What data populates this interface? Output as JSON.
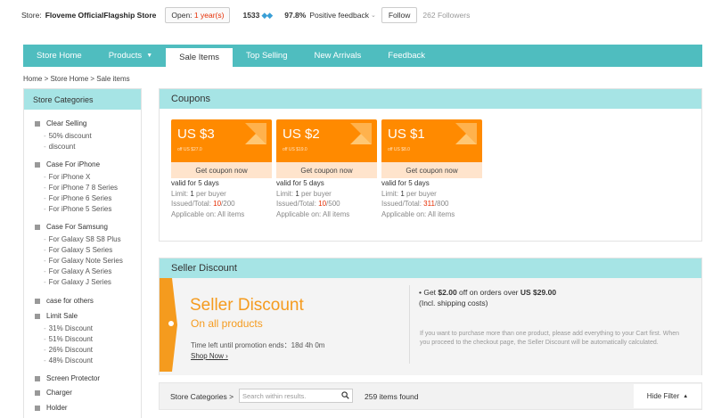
{
  "store": {
    "label": "Store:",
    "name": "Floveme OfficialFlagship Store",
    "open_prefix": "Open: ",
    "open_years": "1 year(s)",
    "score": "1533",
    "feedback_pct": "97.8%",
    "feedback_label": "Positive feedback",
    "follow_label": "Follow",
    "followers": "262 Followers"
  },
  "nav": {
    "items": [
      {
        "label": "Store Home"
      },
      {
        "label": "Products"
      },
      {
        "label": "Sale Items"
      },
      {
        "label": "Top Selling"
      },
      {
        "label": "New Arrivals"
      },
      {
        "label": "Feedback"
      }
    ],
    "active": "Sale Items"
  },
  "breadcrumb": "Home > Store Home > Sale items",
  "sidebar": {
    "title": "Store Categories",
    "categories": [
      {
        "label": "Clear Selling",
        "subs": [
          "50% discount",
          "discount"
        ]
      },
      {
        "label": "Case For iPhone",
        "subs": [
          "For iPhone X",
          "For iPhone 7 8 Series",
          "For iPhone 6 Series",
          "For iPhone 5 Series"
        ]
      },
      {
        "label": "Case For Samsung",
        "subs": [
          "For Galaxy S8 S8 Plus",
          "For Galaxy S Series",
          "For Galaxy Note Series",
          "For Galaxy A Series",
          "For Galaxy J Series"
        ]
      },
      {
        "label": "case for others",
        "subs": []
      },
      {
        "label": "Limit Sale",
        "subs": [
          "31% Discount",
          "51% Discount",
          "26% Discount",
          "48% Discount"
        ]
      },
      {
        "label": "Screen Protector",
        "subs": []
      },
      {
        "label": "Charger",
        "subs": []
      },
      {
        "label": "Holder",
        "subs": []
      }
    ]
  },
  "coupons": {
    "title": "Coupons",
    "button_label": "Get coupon now",
    "validity": "valid for 5 days",
    "limit_label": "Limit: ",
    "limit_value": "1",
    "limit_suffix": " per buyer",
    "issued_label": "Issued/Total: ",
    "applicable": "Applicable on: All items",
    "items": [
      {
        "amount": "US $3",
        "off": "off US $27.0",
        "issued": "10",
        "total": "/200"
      },
      {
        "amount": "US $2",
        "off": "off US $19.0",
        "issued": "10",
        "total": "/500"
      },
      {
        "amount": "US $1",
        "off": "off US $8.0",
        "issued": "311",
        "total": "/800"
      }
    ]
  },
  "seller_discount": {
    "title": "Seller Discount",
    "banner_title": "Seller Discount",
    "banner_sub": "On all products",
    "time_left": "Time left until promotion ends：18d 4h 0m",
    "shop_now": "Shop Now",
    "offer_pre": "• Get ",
    "offer_amount": "$2.00",
    "offer_mid": " off on orders over ",
    "offer_min": "US $29.00",
    "offer_note": "(Incl. shipping costs)",
    "note": "If you want to purchase more than one product, please add everything to your Cart first. When you proceed to the checkout page, the Seller Discount will be automatically calculated."
  },
  "search": {
    "label": "Store Categories >",
    "placeholder": "Search within results.",
    "count": "259 items found",
    "hide_filter": "Hide Filter"
  },
  "colors": {
    "teal": "#4fbdbf",
    "light_teal": "#a6e4e5",
    "orange": "#ff8a00",
    "red": "#e62e04"
  }
}
